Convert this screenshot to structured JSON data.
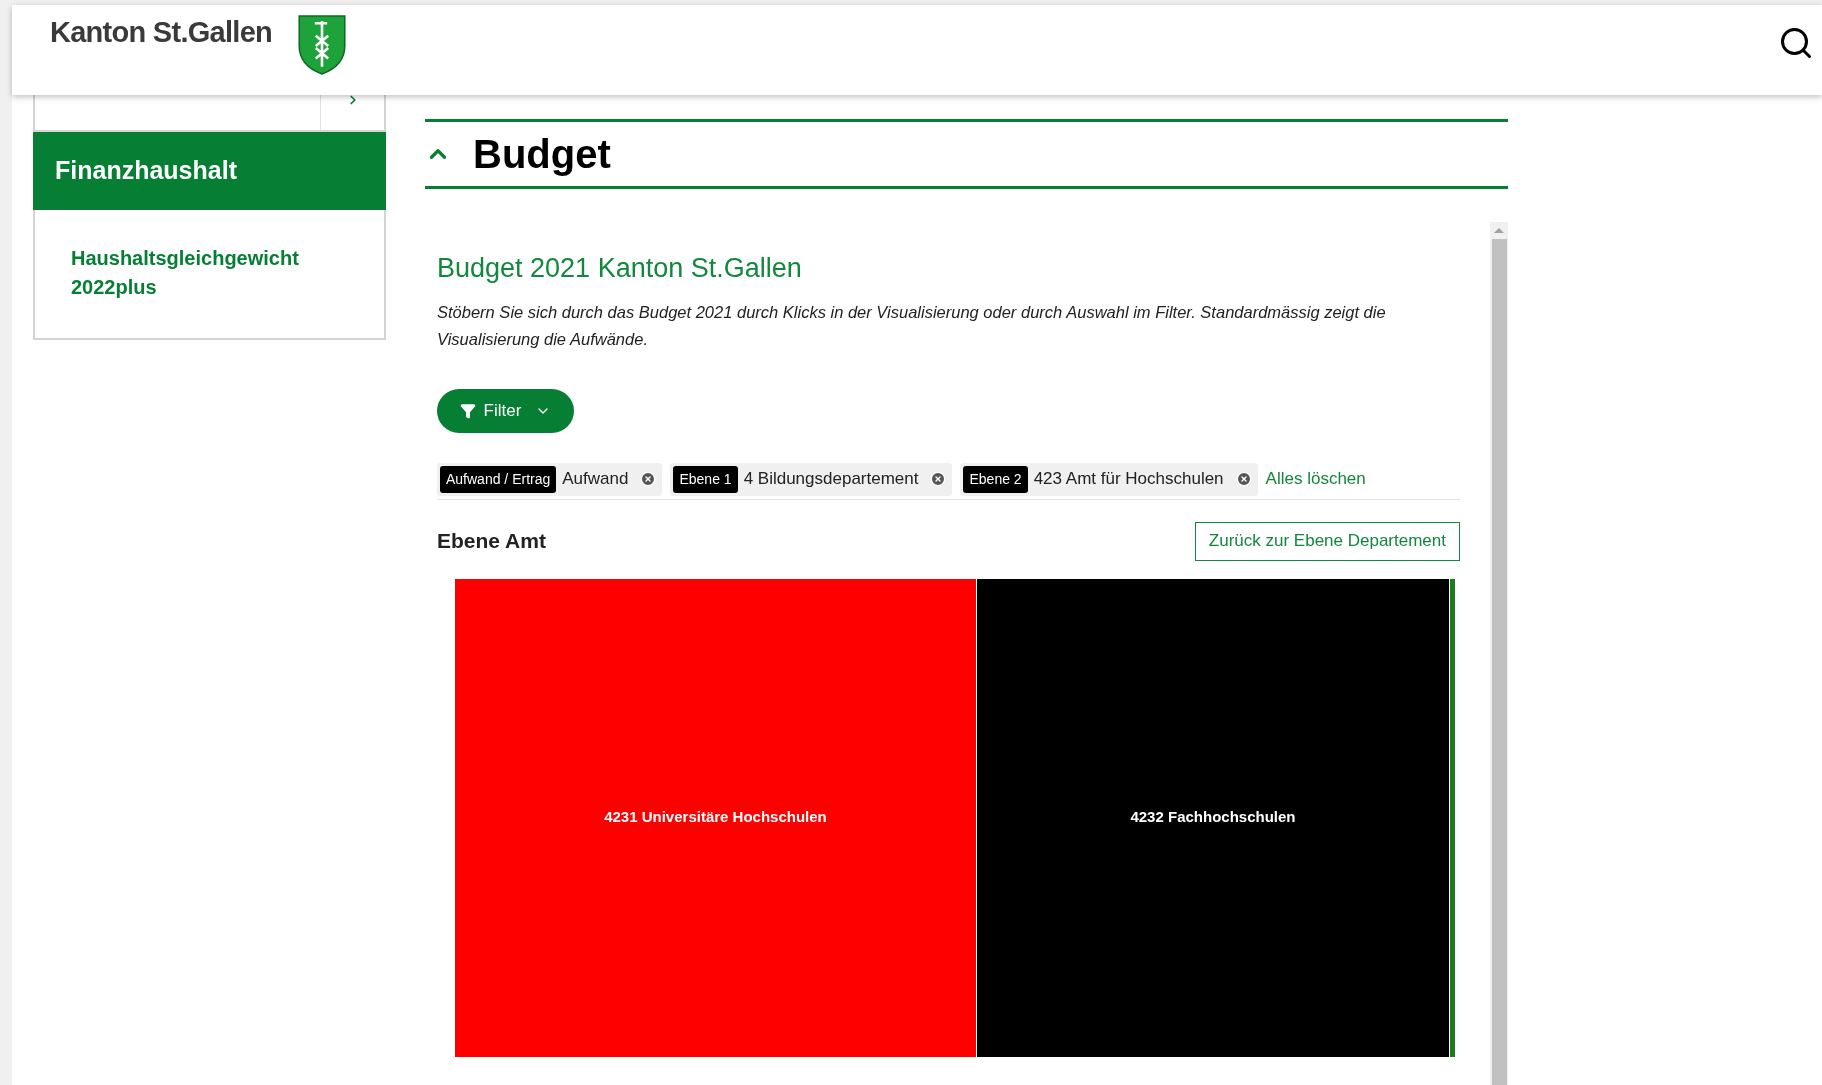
{
  "header": {
    "logo_text": "Kanton St.Gallen"
  },
  "sidebar": {
    "items": [
      {
        "label": "Finanzhaushalt",
        "selected": true,
        "kind": "current"
      },
      {
        "label": "Haushaltsgleichgewicht 2022plus",
        "selected": false,
        "kind": "child"
      }
    ]
  },
  "accordion": [
    {
      "title": "Budget",
      "expanded": true
    }
  ],
  "budget": {
    "title": "Budget 2021 Kanton St.Gallen",
    "description": "Stöbern Sie sich durch das Budget 2021 durch Klicks in der Visualisierung oder durch Auswahl im Filter. Standardmässig zeigt die Visualisierung die Aufwände.",
    "filter_button": "Filter",
    "chips": [
      {
        "tag": "Aufwand / Ertrag",
        "value": "Aufwand"
      },
      {
        "tag": "Ebene 1",
        "value": "4 Bildungsdepartement"
      },
      {
        "tag": "Ebene 2",
        "value": "423 Amt für Hochschulen"
      }
    ],
    "clear_all": "Alles löschen",
    "level_title": "Ebene Amt",
    "back_button": "Zurück zur Ebene Departement",
    "treemap": [
      {
        "label": "4231 Universitäre Hochschulen",
        "color": "#ff0000"
      },
      {
        "label": "4232 Fachhochschulen",
        "color": "#000000"
      },
      {
        "color": "#1e7b1e"
      }
    ]
  }
}
